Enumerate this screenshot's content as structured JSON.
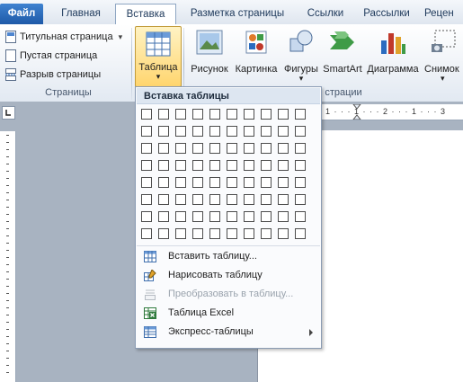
{
  "tabs": {
    "file": "Файл",
    "home": "Главная",
    "insert": "Вставка",
    "layout": "Разметка страницы",
    "references": "Ссылки",
    "mailings": "Рассылки",
    "review": "Рецен"
  },
  "pages_group": {
    "cover": "Титульная страница",
    "cover_arrow": "▾",
    "blank": "Пустая страница",
    "break": "Разрыв страницы",
    "label": "Страницы"
  },
  "table_group": {
    "table": "Таблица",
    "arrow": "▾"
  },
  "illustrations_group": {
    "picture": "Рисунок",
    "clipart": "Картинка",
    "shapes": "Фигуры",
    "shapes_arrow": "▾",
    "smartart": "SmartArt",
    "chart": "Диаграмма",
    "screenshot": "Снимок",
    "screenshot_arrow": "▾",
    "label": "страции"
  },
  "ruler": {
    "marks": "1 · · · 1 · · · 2 · · · 1 · · · 3"
  },
  "table_menu": {
    "title": "Вставка таблицы",
    "grid_cols": 10,
    "grid_rows": 8,
    "items": [
      {
        "label": "Вставить таблицу...",
        "icon": "insert-table-icon",
        "enabled": true
      },
      {
        "label": "Нарисовать таблицу",
        "icon": "draw-table-icon",
        "enabled": true
      },
      {
        "label": "Преобразовать в таблицу...",
        "icon": "convert-to-table-icon",
        "enabled": false
      },
      {
        "label": "Таблица Excel",
        "icon": "excel-table-icon",
        "enabled": true
      },
      {
        "label": "Экспресс-таблицы",
        "icon": "quick-tables-icon",
        "enabled": true
      }
    ]
  },
  "colors": {
    "file_tab": "#2b6cc0",
    "table_highlight": "#ffd56e",
    "ribbon_bg": "#eef2f7"
  }
}
